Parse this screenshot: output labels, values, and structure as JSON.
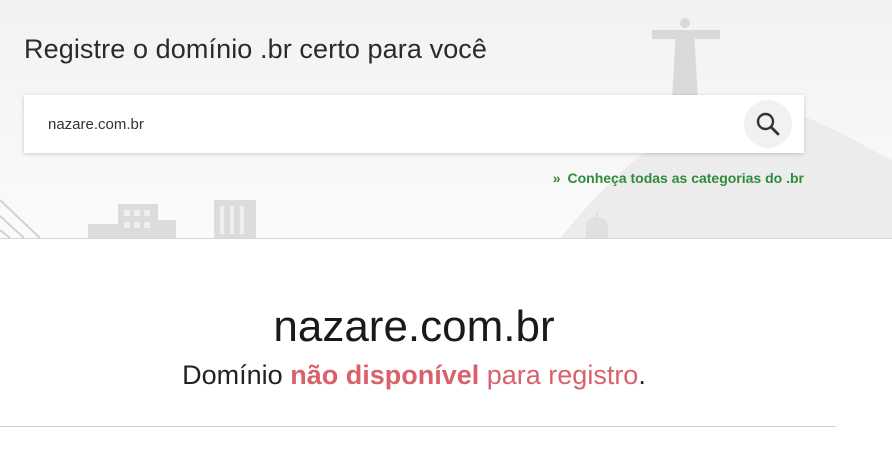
{
  "header": {
    "title": "Registre o domínio .br certo para você"
  },
  "search": {
    "value": "nazare.com.br",
    "button_icon": "search-icon"
  },
  "categories_link": {
    "prefix": "»",
    "label": "Conheça todas as categorias do .br",
    "color": "#2e8b3c"
  },
  "result": {
    "domain": "nazare.com.br",
    "status_prefix": "Domínio",
    "status_highlight": "não disponível",
    "status_suffix": "para registro",
    "status_end": ".",
    "highlight_color": "#d9616b"
  }
}
